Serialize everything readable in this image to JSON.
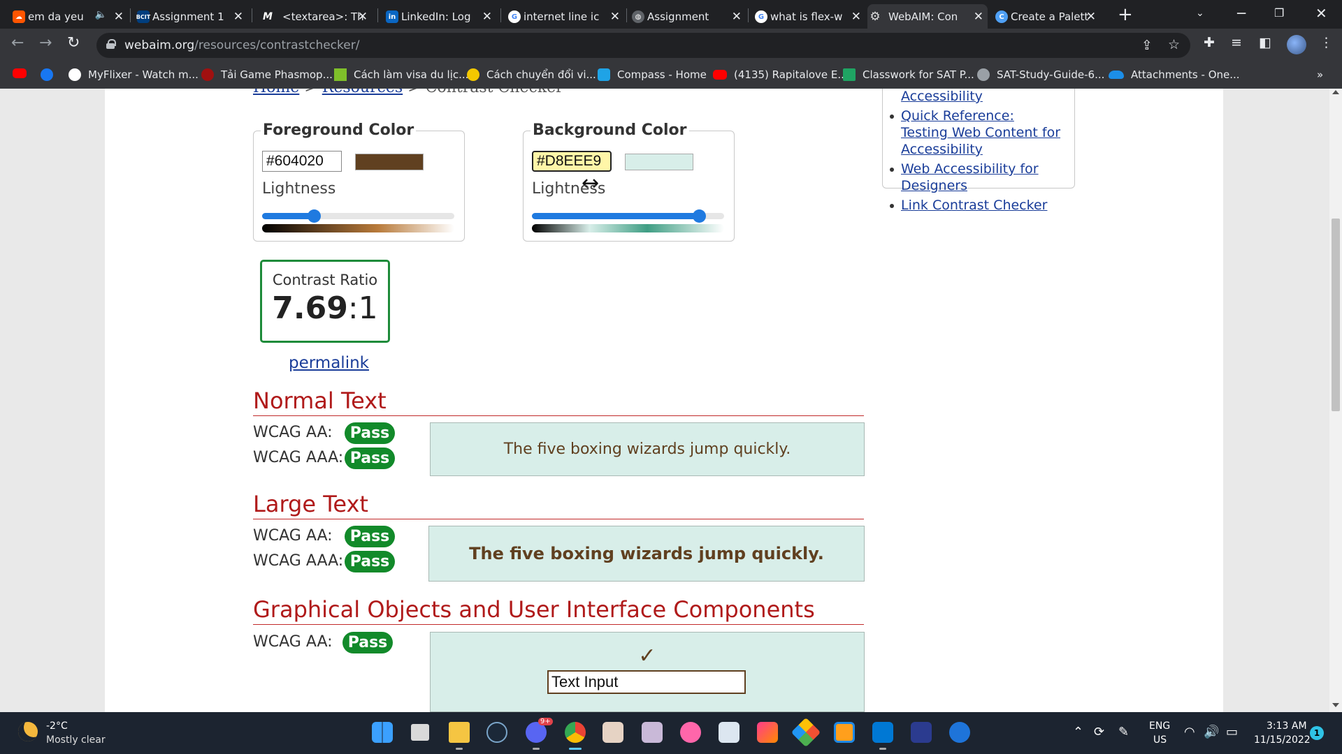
{
  "browser": {
    "tabs": [
      {
        "title": "em da yeu",
        "audio": "🔈",
        "icon": "soundcloud-icon",
        "color": "#ff5500"
      },
      {
        "title": "Assignment 1",
        "icon": "bcit-icon",
        "color": "#003e7e",
        "fav_text": "BCIT"
      },
      {
        "title": "<textarea>: Th",
        "icon": "mdn-icon",
        "color": "#202124",
        "fav_text": "M"
      },
      {
        "title": "LinkedIn: Log",
        "icon": "linkedin-icon",
        "color": "#0a66c2",
        "fav_text": "in"
      },
      {
        "title": "internet line ic",
        "icon": "google-icon",
        "color": "#ffffff",
        "fav_text": "G"
      },
      {
        "title": "Assignment",
        "icon": "globe-icon",
        "color": "#5f6368"
      },
      {
        "title": "what is flex-w",
        "icon": "google-icon",
        "color": "#ffffff",
        "fav_text": "G"
      },
      {
        "title": "WebAIM: Con",
        "icon": "webaim-gear-icon",
        "color": "#cccccc",
        "active": true
      },
      {
        "title": "Create a Palett",
        "icon": "canva-icon",
        "color": "#4fa0f5",
        "fav_text": "C"
      }
    ],
    "url_host": "webaim.org",
    "url_path": "/resources/contrastchecker/",
    "bookmarks": [
      {
        "label": "",
        "icon": "youtube-icon",
        "color": "#ff0000"
      },
      {
        "label": "",
        "icon": "facebook-icon",
        "color": "#1877f2"
      },
      {
        "label": "MyFlixer - Watch m...",
        "icon": "myflixer-icon",
        "color": "#ffffff"
      },
      {
        "label": "Tải Game Phasmop...",
        "icon": "phasmo-icon",
        "color": "#a01010"
      },
      {
        "label": "Cách làm visa du lịc...",
        "icon": "visa-icon",
        "color": "#7fbf2a"
      },
      {
        "label": "Cách chuyển đổi vi...",
        "icon": "convert-icon",
        "color": "#f3c800"
      },
      {
        "label": "Compass - Home",
        "icon": "compass-icon",
        "color": "#1fa3e6"
      },
      {
        "label": "(4135) Rapitalove E...",
        "icon": "youtube-icon",
        "color": "#ff0000"
      },
      {
        "label": "Classwork for SAT P...",
        "icon": "classroom-icon",
        "color": "#1fa463"
      },
      {
        "label": "SAT-Study-Guide-6...",
        "icon": "globe-icon",
        "color": "#9aa0a6"
      },
      {
        "label": "Attachments - One...",
        "icon": "onedrive-icon",
        "color": "#1c8ee8"
      }
    ],
    "more_bookmarks": "»"
  },
  "page": {
    "breadcrumb": {
      "home": "Home",
      "resources": "Resources",
      "current": "Contrast Checker",
      "sep": ">"
    },
    "foreground": {
      "legend": "Foreground Color",
      "hex": "#604020",
      "swatch": "#604020",
      "lightness_label": "Lightness",
      "lightness": 0.27,
      "gradient_mid": "#b87a3a"
    },
    "background": {
      "legend": "Background Color",
      "hex": "#D8EEE9",
      "swatch": "#D8EEE9",
      "lightness_label": "Lightness",
      "lightness": 0.87,
      "gradient_mid": "#3f9e84"
    },
    "swap_icon": "↔",
    "contrast": {
      "label": "Contrast Ratio",
      "ratio": "7.69",
      "suffix": ":1",
      "permalink": "permalink"
    },
    "sections": {
      "normal": {
        "heading": "Normal Text",
        "aa_label": "WCAG AA:",
        "aa_result": "Pass",
        "aaa_label": "WCAG AAA:",
        "aaa_result": "Pass",
        "sample": "The five boxing wizards jump quickly."
      },
      "large": {
        "heading": "Large Text",
        "aa_label": "WCAG AA:",
        "aa_result": "Pass",
        "aaa_label": "WCAG AAA:",
        "aaa_result": "Pass",
        "sample": "The five boxing wizards jump quickly."
      },
      "graphical": {
        "heading": "Graphical Objects and User Interface Components",
        "aa_label": "WCAG AA:",
        "aa_result": "Pass",
        "check": "✓",
        "input_value": "Text Input"
      }
    },
    "sidebar_links": [
      "Contrast and Color Accessibility",
      "Quick Reference: Testing Web Content for Accessibility",
      "Web Accessibility for Designers",
      "Link Contrast Checker"
    ]
  },
  "taskbar": {
    "weather_temp": "-2°C",
    "weather_desc": "Mostly clear",
    "language": "ENG",
    "region": "US",
    "time": "3:13 AM",
    "date": "11/15/2022",
    "notification_count": "1",
    "discord_badge": "9+"
  }
}
